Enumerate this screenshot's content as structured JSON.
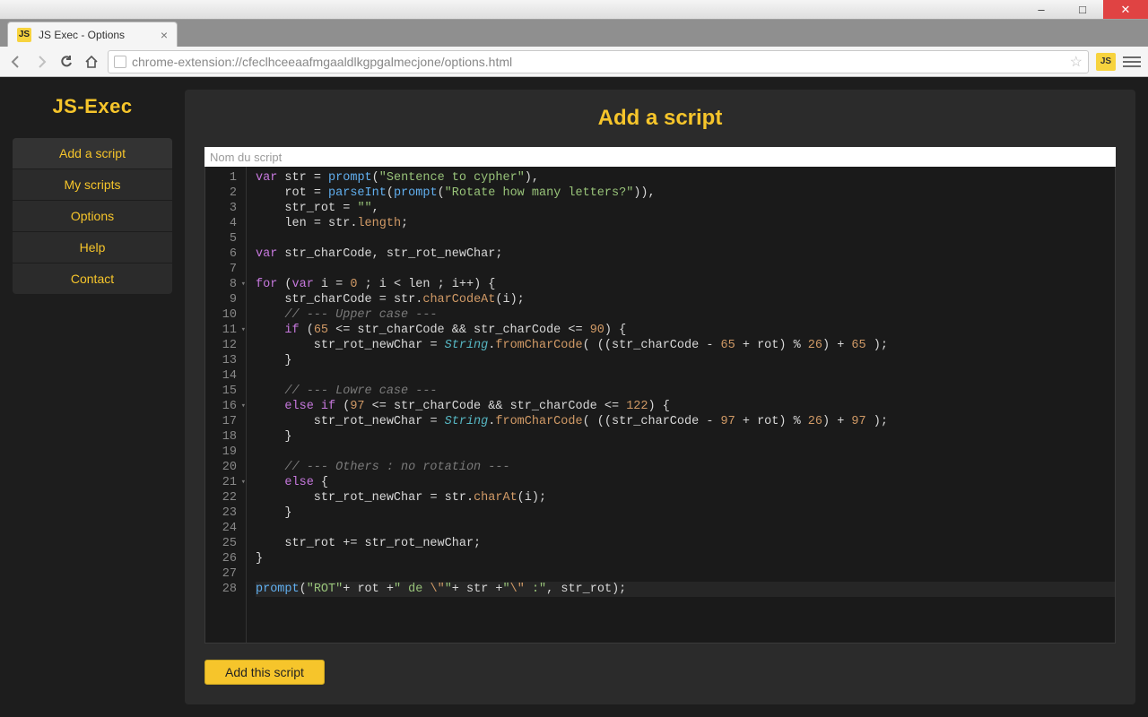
{
  "window": {
    "min": "–",
    "max": "□",
    "close": "✕"
  },
  "tab": {
    "favicon": "JS",
    "title": "JS Exec - Options",
    "close": "×"
  },
  "toolbar": {
    "url": "chrome-extension://cfeclhceeaafmgaaldlkgpgalmecjone/options.html",
    "ext_badge": "JS"
  },
  "sidebar": {
    "logo": "JS-Exec",
    "items": [
      {
        "label": "Add a script",
        "active": true
      },
      {
        "label": "My scripts",
        "active": false
      },
      {
        "label": "Options",
        "active": false
      },
      {
        "label": "Help",
        "active": false
      },
      {
        "label": "Contact",
        "active": false
      }
    ]
  },
  "main": {
    "heading": "Add a script",
    "name_placeholder": "Nom du script",
    "add_button": "Add this script"
  },
  "code": {
    "lines": [
      {
        "n": 1,
        "fold": false,
        "html": "<span class='kw'>var</span> str <span class='op'>=</span> <span class='fn'>prompt</span>(<span class='str'>\"Sentence to cypher\"</span>),"
      },
      {
        "n": 2,
        "fold": false,
        "html": "    rot <span class='op'>=</span> <span class='fn'>parseInt</span>(<span class='fn'>prompt</span>(<span class='str'>\"Rotate how many letters?\"</span>)),"
      },
      {
        "n": 3,
        "fold": false,
        "html": "    str_rot <span class='op'>=</span> <span class='str'>\"\"</span>,"
      },
      {
        "n": 4,
        "fold": false,
        "html": "    len <span class='op'>=</span> str.<span class='prop'>length</span>;"
      },
      {
        "n": 5,
        "fold": false,
        "html": ""
      },
      {
        "n": 6,
        "fold": false,
        "html": "<span class='kw'>var</span> str_charCode, str_rot_newChar;"
      },
      {
        "n": 7,
        "fold": false,
        "html": ""
      },
      {
        "n": 8,
        "fold": true,
        "html": "<span class='kw'>for</span> (<span class='kw'>var</span> i <span class='op'>=</span> <span class='num'>0</span> ; i <span class='op'>&lt;</span> len ; i<span class='op'>++</span>) {"
      },
      {
        "n": 9,
        "fold": false,
        "html": "    str_charCode <span class='op'>=</span> str.<span class='prop'>charCodeAt</span>(i);"
      },
      {
        "n": 10,
        "fold": false,
        "html": "    <span class='cmt'>// --- Upper case ---</span>"
      },
      {
        "n": 11,
        "fold": true,
        "html": "    <span class='kw'>if</span> (<span class='num'>65</span> <span class='op'>&lt;=</span> str_charCode <span class='op'>&amp;&amp;</span> str_charCode <span class='op'>&lt;=</span> <span class='num'>90</span>) {"
      },
      {
        "n": 12,
        "fold": false,
        "html": "        str_rot_newChar <span class='op'>=</span> <span class='cls'>String</span>.<span class='prop'>fromCharCode</span>( ((str_charCode <span class='op'>-</span> <span class='num'>65</span> <span class='op'>+</span> rot) <span class='op'>%</span> <span class='num'>26</span>) <span class='op'>+</span> <span class='num'>65</span> );"
      },
      {
        "n": 13,
        "fold": false,
        "html": "    }"
      },
      {
        "n": 14,
        "fold": false,
        "html": ""
      },
      {
        "n": 15,
        "fold": false,
        "html": "    <span class='cmt'>// --- Lowre case ---</span>"
      },
      {
        "n": 16,
        "fold": true,
        "html": "    <span class='kw'>else</span> <span class='kw'>if</span> (<span class='num'>97</span> <span class='op'>&lt;=</span> str_charCode <span class='op'>&amp;&amp;</span> str_charCode <span class='op'>&lt;=</span> <span class='num'>122</span>) {"
      },
      {
        "n": 17,
        "fold": false,
        "html": "        str_rot_newChar <span class='op'>=</span> <span class='cls'>String</span>.<span class='prop'>fromCharCode</span>( ((str_charCode <span class='op'>-</span> <span class='num'>97</span> <span class='op'>+</span> rot) <span class='op'>%</span> <span class='num'>26</span>) <span class='op'>+</span> <span class='num'>97</span> );"
      },
      {
        "n": 18,
        "fold": false,
        "html": "    }"
      },
      {
        "n": 19,
        "fold": false,
        "html": ""
      },
      {
        "n": 20,
        "fold": false,
        "html": "    <span class='cmt'>// --- Others : no rotation ---</span>"
      },
      {
        "n": 21,
        "fold": true,
        "html": "    <span class='kw'>else</span> {"
      },
      {
        "n": 22,
        "fold": false,
        "html": "        str_rot_newChar <span class='op'>=</span> str.<span class='prop'>charAt</span>(i);"
      },
      {
        "n": 23,
        "fold": false,
        "html": "    }"
      },
      {
        "n": 24,
        "fold": false,
        "html": ""
      },
      {
        "n": 25,
        "fold": false,
        "html": "    str_rot <span class='op'>+=</span> str_rot_newChar;"
      },
      {
        "n": 26,
        "fold": false,
        "html": "}"
      },
      {
        "n": 27,
        "fold": false,
        "html": ""
      },
      {
        "n": 28,
        "fold": false,
        "active": true,
        "html": "<span class='fn'>prompt</span>(<span class='str'>\"ROT\"</span><span class='op'>+</span> rot <span class='op'>+</span><span class='str'>\" de </span><span class='esc'>\\\"</span><span class='str'>\"</span><span class='op'>+</span> str <span class='op'>+</span><span class='str'>\"</span><span class='esc'>\\\"</span><span class='str'> :\"</span>, str_rot);"
      }
    ]
  }
}
